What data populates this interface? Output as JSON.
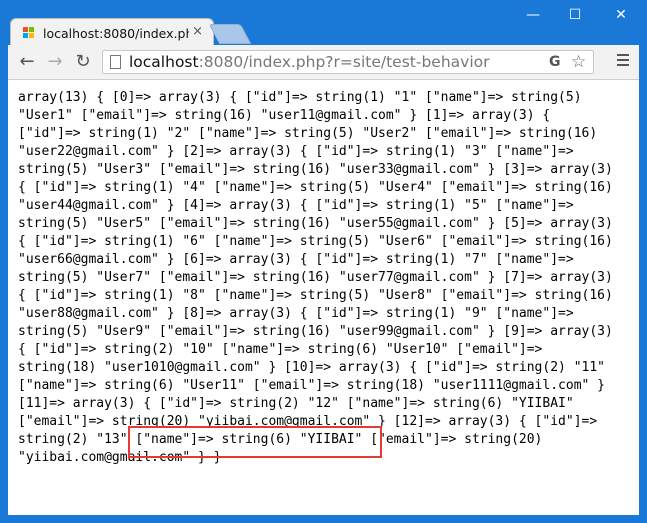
{
  "browser": {
    "tab_title": "localhost:8080/index.ph",
    "tab_close": "×",
    "url_host": "localhost",
    "url_rest": ":8080/index.php?r=site/test-behavior",
    "window_controls": {
      "minimize": "—",
      "maximize": "☐",
      "close": "✕"
    },
    "nav": {
      "back": "←",
      "forward": "→",
      "reload": "↻"
    },
    "omnibox_icons": [
      "translate-icon",
      "star-icon"
    ],
    "icons": {
      "translate": "G",
      "star": "☆"
    }
  },
  "page": {
    "dump_lines": [
      "array(13) { [0]=> array(3) { [\"id\"]=> string(1) \"1\" [\"name\"]=> string(5)",
      "\"User1\" [\"email\"]=> string(16) \"user11@gmail.com\" } [1]=> array(3) {",
      "[\"id\"]=> string(1) \"2\" [\"name\"]=> string(5) \"User2\" [\"email\"]=> string(16)",
      "\"user22@gmail.com\" } [2]=> array(3) { [\"id\"]=> string(1) \"3\" [\"name\"]=>",
      "string(5) \"User3\" [\"email\"]=> string(16) \"user33@gmail.com\" } [3]=> array(3)",
      "{ [\"id\"]=> string(1) \"4\" [\"name\"]=> string(5) \"User4\" [\"email\"]=> string(16)",
      "\"user44@gmail.com\" } [4]=> array(3) { [\"id\"]=> string(1) \"5\" [\"name\"]=>",
      "string(5) \"User5\" [\"email\"]=> string(16) \"user55@gmail.com\" } [5]=> array(3)",
      "{ [\"id\"]=> string(1) \"6\" [\"name\"]=> string(5) \"User6\" [\"email\"]=> string(16)",
      "\"user66@gmail.com\" } [6]=> array(3) { [\"id\"]=> string(1) \"7\" [\"name\"]=>",
      "string(5) \"User7\" [\"email\"]=> string(16) \"user77@gmail.com\" } [7]=> array(3)",
      "{ [\"id\"]=> string(1) \"8\" [\"name\"]=> string(5) \"User8\" [\"email\"]=> string(16)",
      "\"user88@gmail.com\" } [8]=> array(3) { [\"id\"]=> string(1) \"9\" [\"name\"]=>",
      "string(5) \"User9\" [\"email\"]=> string(16) \"user99@gmail.com\" } [9]=> array(3)",
      "{ [\"id\"]=> string(2) \"10\" [\"name\"]=> string(6) \"User10\" [\"email\"]=>",
      "string(18) \"user1010@gmail.com\" } [10]=> array(3) { [\"id\"]=> string(2) \"11\"",
      "[\"name\"]=> string(6) \"User11\" [\"email\"]=> string(18) \"user1111@gmail.com\" }",
      "[11]=> array(3) { [\"id\"]=> string(2) \"12\" [\"name\"]=> string(6) \"YIIBAI\"",
      "[\"email\"]=> string(20) \"yiibai.com@gmail.com\" } [12]=> array(3) { [\"id\"]=>",
      "string(2) \"13\" [\"name\"]=> string(6) \"YIIBAI\" [\"email\"]=> string(20)",
      "\"yiibai.com@gmail.com\" } }"
    ]
  },
  "colors": {
    "titlebar": "#1a79d6",
    "highlight": "#e53935"
  }
}
